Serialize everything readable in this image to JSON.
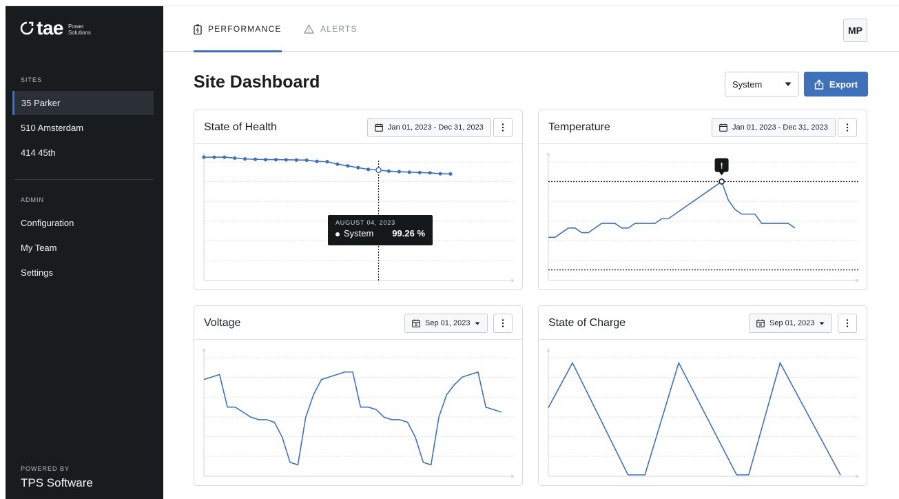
{
  "brand": {
    "name": "tae",
    "subtitle_line1": "Power",
    "subtitle_line2": "Solutions"
  },
  "sidebar": {
    "sites_heading": "SITES",
    "sites": [
      {
        "label": "35 Parker",
        "active": true
      },
      {
        "label": "510 Amsterdam",
        "active": false
      },
      {
        "label": "414 45th",
        "active": false
      }
    ],
    "admin_heading": "ADMIN",
    "admin_items": [
      {
        "label": "Configuration"
      },
      {
        "label": "My Team"
      },
      {
        "label": "Settings"
      }
    ],
    "powered_label": "POWERED BY",
    "powered_name": "TPS Software"
  },
  "topbar": {
    "tabs": [
      {
        "label": "PERFORMANCE",
        "icon": "battery-icon",
        "active": true
      },
      {
        "label": "ALERTS",
        "icon": "warning-icon",
        "active": false
      }
    ],
    "avatar": "MP"
  },
  "page": {
    "title": "Site Dashboard",
    "filter_value": "System",
    "export_label": "Export"
  },
  "cards": [
    {
      "title": "State of Health",
      "date_range": "Jan 01, 2023 - Dec 31, 2023"
    },
    {
      "title": "Temperature",
      "date_range": "Jan 01, 2023 - Dec 31, 2023"
    },
    {
      "title": "Voltage",
      "date_range": "Sep 01, 2023"
    },
    {
      "title": "State of Charge",
      "date_range": "Sep 01, 2023"
    }
  ],
  "tooltip": {
    "date": "AUGUST 04, 2023",
    "series": "System",
    "value": "99.26 %"
  },
  "alert_marker": "!",
  "colors": {
    "sidebar_bg": "#181c1f",
    "accent": "#3f71b8",
    "line": "#3f71b8"
  },
  "chart_data": [
    {
      "type": "line",
      "title": "State of Health",
      "series": [
        {
          "name": "System",
          "values": [
            100.0,
            100.0,
            100.0,
            99.95,
            99.9,
            99.88,
            99.86,
            99.86,
            99.85,
            99.84,
            99.83,
            99.76,
            99.74,
            99.6,
            99.5,
            99.4,
            99.3,
            99.26,
            99.2,
            99.17,
            99.14,
            99.12,
            99.1,
            99.05,
            99.04
          ]
        }
      ],
      "ylim": [
        93,
        100.2
      ],
      "highlight_index": 17,
      "grid": true
    },
    {
      "type": "line",
      "title": "Temperature",
      "series": [
        {
          "values": [
            22,
            22,
            23,
            24,
            24,
            23,
            23,
            24,
            25,
            25,
            25,
            24,
            24,
            25,
            25,
            25,
            25,
            26,
            26,
            27,
            28,
            29,
            30,
            31,
            32,
            33,
            34,
            30,
            28,
            27,
            27,
            27,
            25,
            25,
            25,
            25,
            25,
            24
          ]
        }
      ],
      "thresholds": [
        34,
        15
      ],
      "ylim": [
        13,
        40
      ],
      "alert_index": 26,
      "grid": true
    },
    {
      "type": "line",
      "title": "Voltage",
      "series": [
        {
          "values": [
            58,
            59,
            60,
            47,
            47,
            45,
            43,
            42,
            42,
            41,
            35,
            25,
            24,
            43,
            52,
            58,
            59,
            60,
            61,
            61,
            47,
            47,
            46,
            43,
            42,
            42,
            41,
            35,
            25,
            24,
            43,
            52,
            56,
            59,
            60,
            61,
            47,
            46,
            45
          ]
        }
      ],
      "ylim": [
        20,
        70
      ],
      "grid": true
    },
    {
      "type": "line",
      "title": "State of Charge",
      "series": [
        {
          "values": [
            60,
            100,
            0,
            0,
            100,
            0,
            0,
            100,
            0
          ]
        }
      ],
      "x": [
        0,
        1,
        3.3,
        4,
        5.4,
        7.8,
        8.3,
        9.6,
        12.1
      ],
      "ylim": [
        0,
        112
      ],
      "grid": true
    }
  ]
}
